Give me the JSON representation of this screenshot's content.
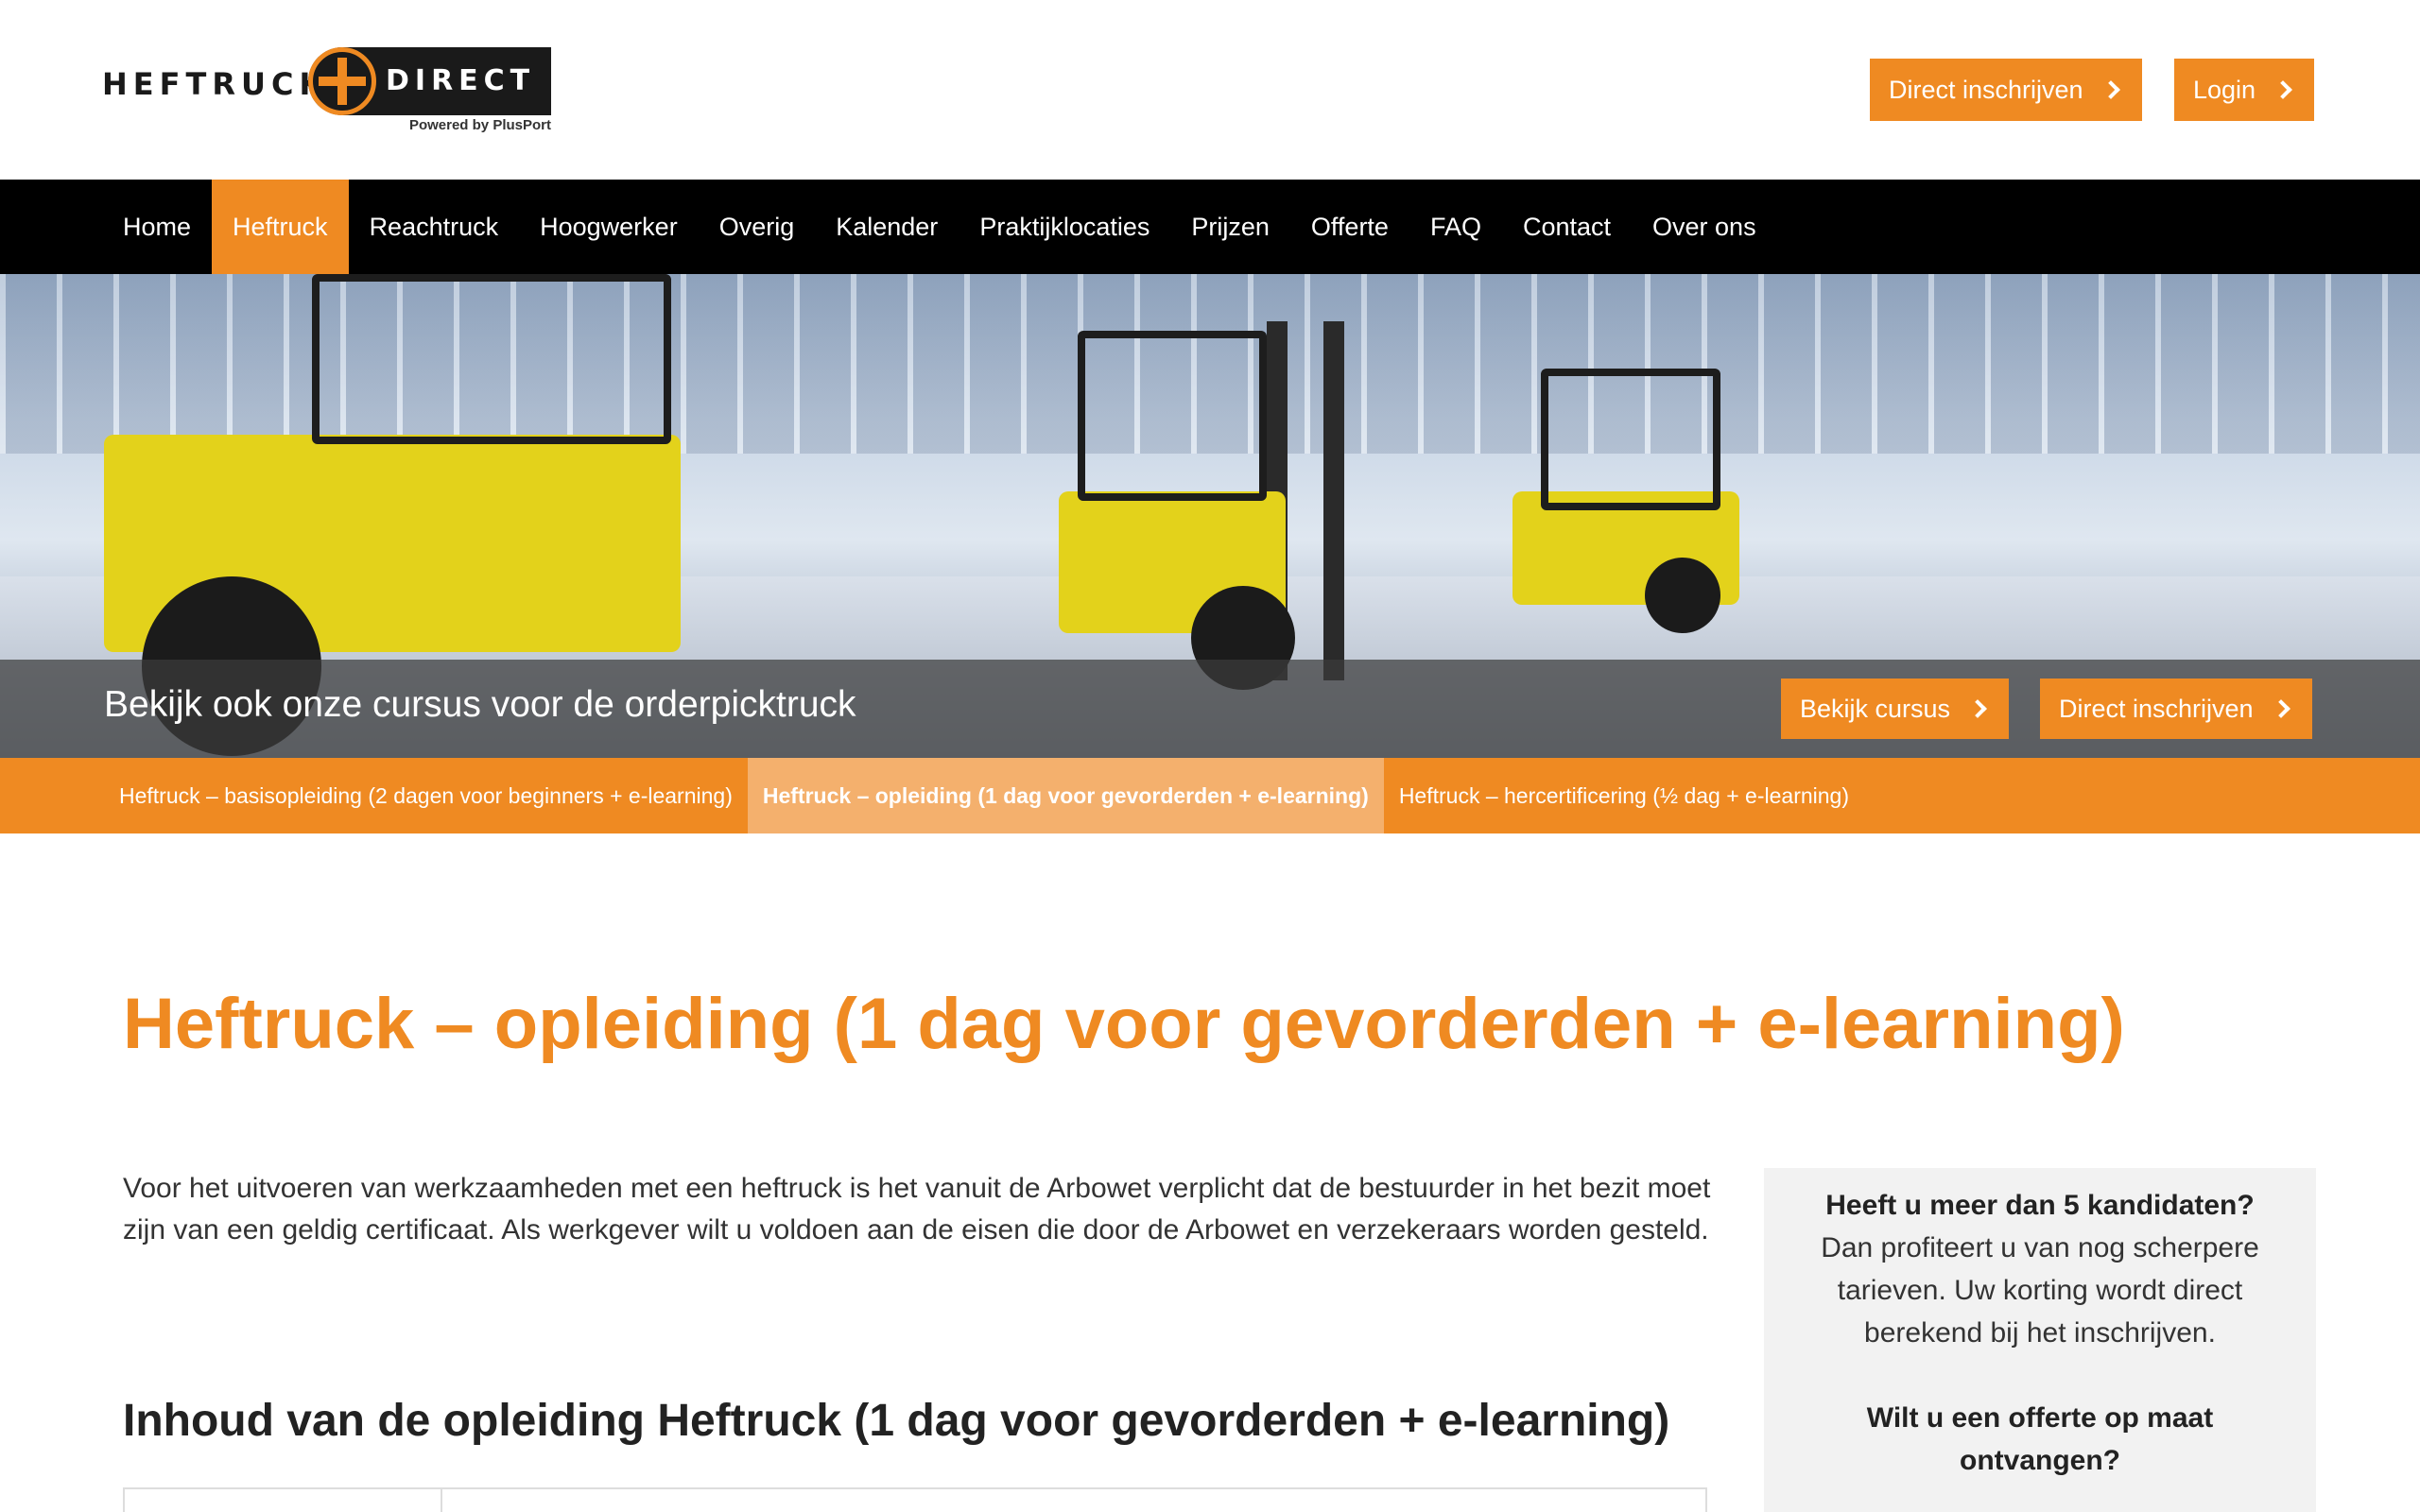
{
  "brand": {
    "word_left": "HEFTRUCK",
    "word_right": "DIRECT",
    "powered_by": "Powered by PlusPort",
    "accent_color": "#ef8a22"
  },
  "header": {
    "signup_label": "Direct inschrijven",
    "login_label": "Login"
  },
  "nav": {
    "items": [
      {
        "label": "Home"
      },
      {
        "label": "Heftruck",
        "active": true
      },
      {
        "label": "Reachtruck"
      },
      {
        "label": "Hoogwerker"
      },
      {
        "label": "Overig"
      },
      {
        "label": "Kalender"
      },
      {
        "label": "Praktijklocaties"
      },
      {
        "label": "Prijzen"
      },
      {
        "label": "Offerte"
      },
      {
        "label": "FAQ"
      },
      {
        "label": "Contact"
      },
      {
        "label": "Over ons"
      }
    ]
  },
  "hero": {
    "banner_text": "Bekijk ook onze cursus voor de orderpicktruck",
    "view_course_label": "Bekijk cursus",
    "signup_label": "Direct inschrijven"
  },
  "subnav": {
    "items": [
      {
        "label": "Heftruck – basisopleiding (2 dagen voor beginners + e-learning)"
      },
      {
        "label": "Heftruck – opleiding (1 dag voor gevorderden + e-learning)",
        "active": true
      },
      {
        "label": "Heftruck – hercertificering (½ dag + e-learning)"
      }
    ]
  },
  "main": {
    "title": "Heftruck – opleiding (1 dag voor gevorderden + e-learning)",
    "intro": "Voor het uitvoeren van werkzaamheden met een heftruck is het vanuit de Arbowet verplicht dat de bestuurder in het bezit moet zijn van een geldig certificaat. Als werkgever wilt u voldoen aan de eisen die door de Arbowet en verzekeraars worden gesteld.",
    "section_title": "Inhoud van de opleiding Heftruck (1 dag voor gevorderden + e-learning)"
  },
  "sidebar": {
    "question1": "Heeft u meer dan 5 kandidaten?",
    "text1": "Dan profiteert u van nog scherpere tarieven. Uw korting wordt direct berekend bij het inschrijven.",
    "question2": "Wilt u een offerte op maat ontvangen?"
  }
}
